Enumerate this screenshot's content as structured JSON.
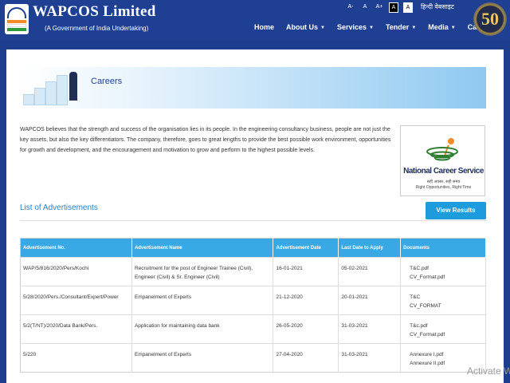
{
  "header": {
    "brand": "WAPCOS Limited",
    "tagline": "(A Government of India Undertaking)",
    "badge": "50",
    "toolbar": {
      "font_minus": "A-",
      "font_normal": "A",
      "font_plus": "A+",
      "contrast_dark": "A",
      "contrast_light": "A",
      "language": "हिन्दी वेबसाइट"
    },
    "nav": [
      {
        "label": "Home",
        "dropdown": false
      },
      {
        "label": "About Us",
        "dropdown": true
      },
      {
        "label": "Services",
        "dropdown": true
      },
      {
        "label": "Tender",
        "dropdown": true
      },
      {
        "label": "Media",
        "dropdown": true
      },
      {
        "label": "Career",
        "dropdown": false
      }
    ],
    "colors": {
      "bar": "#1e3f92",
      "text": "#ffffff"
    }
  },
  "page": {
    "banner_title": "Careers",
    "intro": "WAPCOS believes that the strength and success of the organisation lies in its people. In the engineering consultancy business, people are not just the key assets, but also the key differentiators. The company, therefore, goes to great lengths to provide the best possible work environment, opportunities for growth and development, and the encouragement and motivation to grow and perform to the highest possible levels.",
    "ncs": {
      "title": "National Career Service",
      "sub_hindi": "सही अवसर, सही समय",
      "sub_english": "Right Opportunities, Right Time"
    },
    "section_title": "List of Advertisements",
    "view_results": "View Results",
    "accent": "#1e9bdd"
  },
  "table": {
    "headers": [
      "Advertisement No.",
      "Advertisement Name",
      "Advertisement Date",
      "Last Date to Apply",
      "Documents"
    ],
    "rows": [
      {
        "no": "WAP/5/816/2020/Pers/Kochi",
        "name": "Recruitment for the post of Engineer Trainee (Civil), Engineer (Civil) & Sr. Engineer (Civil)",
        "date": "16-01-2021",
        "last": "05-02-2021",
        "docs": [
          "T&C.pdf",
          "CV_Format.pdf"
        ]
      },
      {
        "no": "5/28/2020/Pers./Consultant/Expert/Power",
        "name": "Empanelment of Experts",
        "date": "21-12-2020",
        "last": "20-01-2021",
        "docs": [
          "T&C",
          "CV_FORMAT"
        ]
      },
      {
        "no": "5/2(T/NT)/2020/Data Bank/Pers.",
        "name": "Application for maintaining data bank",
        "date": "26-05-2020",
        "last": "31-03-2021",
        "docs": [
          "T&c.pdf",
          "CV_Format.pdf"
        ]
      },
      {
        "no": "5/220",
        "name": "Empanelment of Experts",
        "date": "27-04-2020",
        "last": "31-03-2021",
        "docs": [
          "Annexure I.pdf",
          "Annexure II.pdf"
        ]
      }
    ]
  },
  "watermark": "Activate W"
}
